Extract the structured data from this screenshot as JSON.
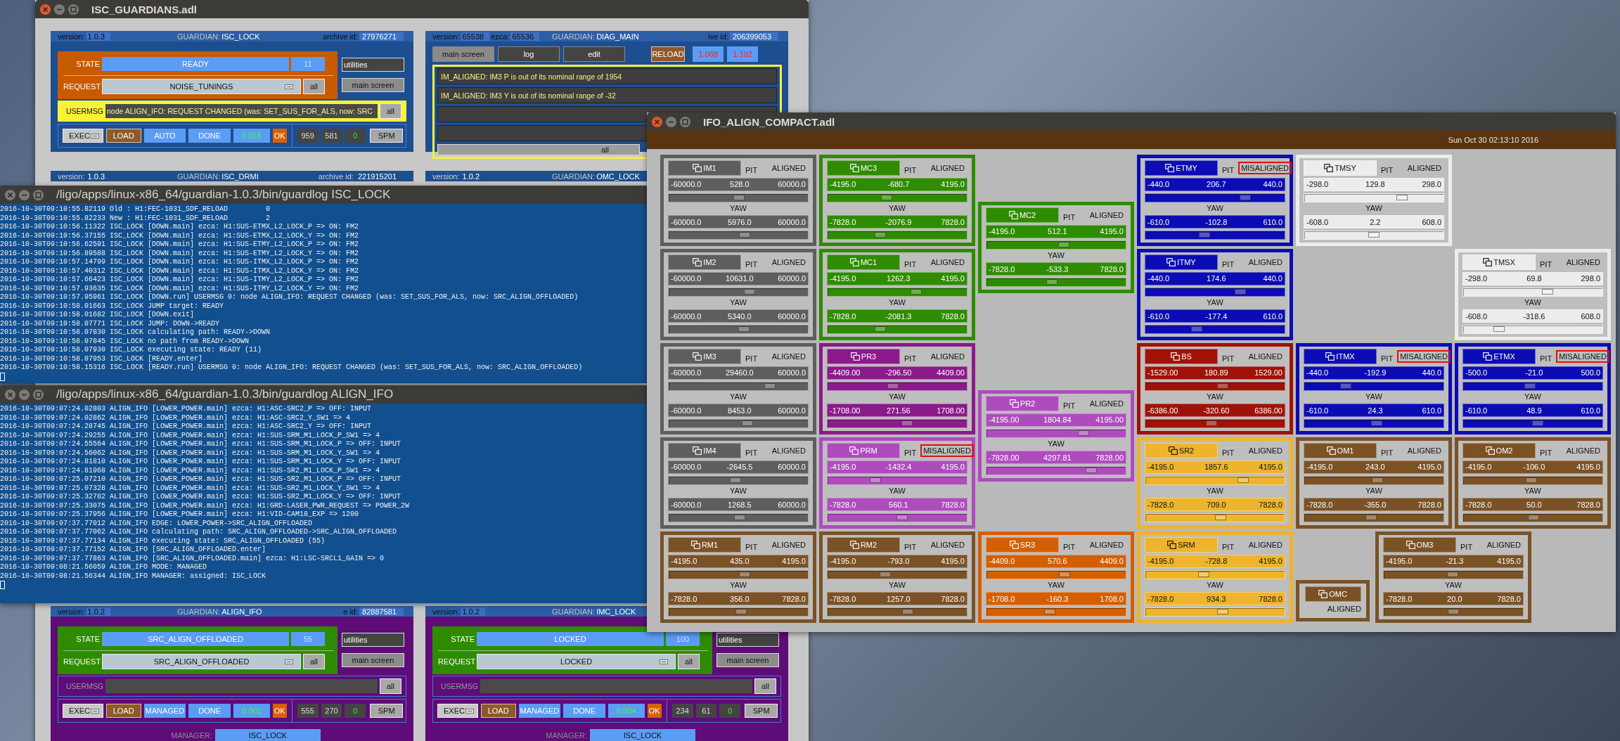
{
  "guardian_window": {
    "title": "ISC_GUARDIANS.adl",
    "rows": [
      [
        {
          "kind": "node",
          "color": "#1d4e8f",
          "state_box": {
            "color": "#c85a00"
          },
          "header": {
            "version_label": "version:",
            "version": "1.0.3",
            "guardian_label": "GUARDIAN:",
            "guardian": "ISC_LOCK",
            "id_label": "archive id:",
            "id": "27976271"
          },
          "state_label": "STATE",
          "state": "READY",
          "state_index": "11",
          "request_label": "REQUEST",
          "request": "NOISE_TUNINGS",
          "request_all": "all",
          "side_buttons": [
            "utilities",
            "main screen"
          ],
          "usermsg_label": "USERMSG",
          "usermsg": "node ALIGN_IFO: REQUEST CHANGED (was: SET_SUS_FOR_ALS, now: SRC",
          "usermsg_alert": true,
          "usermsg_all": "all",
          "exec": "EXEC",
          "load": "LOAD",
          "mode": "AUTO",
          "status": "DONE",
          "timing": "0.018",
          "ok": "OK",
          "counters": [
            "959",
            "581",
            "0"
          ],
          "spm": "SPM"
        },
        {
          "kind": "diag",
          "color": "#1d4e8f",
          "header": {
            "version_label": "version:",
            "version": "65538",
            "ezca_label": "ezca:",
            "ezca": "65536",
            "guardian_label": "GUARDIAN:",
            "guardian": "DIAG_MAIN",
            "id_label": "ive id:",
            "id": "206399053"
          },
          "buttons": [
            "main screen",
            "log",
            "edit"
          ],
          "reload": "RELOAD",
          "readings": [
            "1.068",
            "1.102"
          ],
          "messages": [
            "IM_ALIGNED: IM3 P is out of its nominal range of 1954",
            "IM_ALIGNED: IM3 Y is out of its nominal range of -32"
          ],
          "all": "all"
        }
      ],
      [
        {
          "kind": "strip",
          "color": "#1d4e8f",
          "header": {
            "version_label": "version:",
            "version": "1.0.3",
            "guardian_label": "GUARDIAN:",
            "guardian": "ISC_DRMI",
            "id_label": "archive id:",
            "id": "221915201"
          }
        },
        {
          "kind": "strip",
          "color": "#1d4e8f",
          "header": {
            "version_label": "version:",
            "version": "1.0.2",
            "guardian_label": "GUARDIAN:",
            "guardian": "OMC_LOCK"
          }
        }
      ],
      [
        {
          "kind": "node",
          "color": "#5e0c78",
          "state_box": {
            "color": "#2f8c00"
          },
          "header": {
            "version_label": "version:",
            "version": "1.0.2",
            "guardian_label": "GUARDIAN:",
            "guardian": "ALIGN_IFO",
            "id_label": "e id:",
            "id": "82887581"
          },
          "state_label": "STATE",
          "state": "SRC_ALIGN_OFFLOADED",
          "state_index": "55",
          "request_label": "REQUEST",
          "request": "SRC_ALIGN_OFFLOADED",
          "request_all": "all",
          "side_buttons": [
            "utilities",
            "main screen"
          ],
          "usermsg_label": "USERMSG",
          "usermsg_alert": false,
          "usermsg_all": "all",
          "exec": "EXEC",
          "load": "LOAD",
          "mode": "MANAGED",
          "status": "DONE",
          "timing": "0.001",
          "ok": "OK",
          "counters": [
            "555",
            "270",
            "0"
          ],
          "spm": "SPM",
          "manager_label": "MANAGER:",
          "manager": "ISC_LOCK"
        },
        {
          "kind": "node",
          "color": "#5e0c78",
          "state_box": {
            "color": "#2f8c00"
          },
          "header": {
            "version_label": "version:",
            "version": "1.0.2",
            "guardian_label": "GUARDIAN:",
            "guardian": "IMC_LOCK"
          },
          "state_label": "STATE",
          "state": "LOCKED",
          "state_index": "100",
          "request_label": "REQUEST",
          "request": "LOCKED",
          "request_all": "all",
          "side_buttons": [
            "utilities",
            "main screen"
          ],
          "usermsg_label": "USERMSG",
          "usermsg_alert": false,
          "usermsg_all": "all",
          "exec": "EXEC",
          "load": "LOAD",
          "mode": "MANAGED",
          "status": "DONE",
          "timing": "0.004",
          "ok": "OK",
          "counters": [
            "234",
            "61",
            "0"
          ],
          "spm": "SPM",
          "manager_label": "MANAGER:",
          "manager": "ISC_LOCK"
        }
      ]
    ]
  },
  "terminals": [
    {
      "title": "/ligo/apps/linux-x86_64/guardian-1.0.3/bin/guardlog ISC_LOCK",
      "lines": [
        "2016-10-30T09:10:55.82119 Old : H1:FEC-1031_SDF_RELOAD         0",
        "2016-10-30T09:10:55.82233 New : H1:FEC-1031_SDF_RELOAD         2",
        "2016-10-30T09:10:56.11322 ISC_LOCK [DOWN.main] ezca: H1:SUS-ETMX_L2_LOCK_P => ON: FM2",
        "2016-10-30T09:10:56.37155 ISC_LOCK [DOWN.main] ezca: H1:SUS-ETMX_L2_LOCK_Y => ON: FM2",
        "2016-10-30T09:10:56.62591 ISC_LOCK [DOWN.main] ezca: H1:SUS-ETMY_L2_LOCK_P => ON: FM2",
        "2016-10-30T09:10:56.89588 ISC_LOCK [DOWN.main] ezca: H1:SUS-ETMY_L2_LOCK_Y => ON: FM2",
        "2016-10-30T09:10:57.14799 ISC_LOCK [DOWN.main] ezca: H1:SUS-ITMX_L2_LOCK_P => ON: FM2",
        "2016-10-30T09:10:57.40312 ISC_LOCK [DOWN.main] ezca: H1:SUS-ITMX_L2_LOCK_Y => ON: FM2",
        "2016-10-30T09:10:57.66423 ISC_LOCK [DOWN.main] ezca: H1:SUS-ITMY_L2_LOCK_P => ON: FM2",
        "2016-10-30T09:10:57.93635 ISC_LOCK [DOWN.main] ezca: H1:SUS-ITMY_L2_LOCK_Y => ON: FM2",
        "2016-10-30T09:10:57.95961 ISC_LOCK [DOWN.run] USERMSG 0: node ALIGN_IFO: REQUEST CHANGED (was: SET_SUS_FOR_ALS, now: SRC_ALIGN_OFFLOADED)",
        "2016-10-30T09:10:58.01663 ISC_LOCK JUMP target: READY",
        "2016-10-30T09:10:58.01682 ISC_LOCK [DOWN.exit]",
        "2016-10-30T09:10:58.07771 ISC_LOCK JUMP: DOWN->READY",
        "2016-10-30T09:10:58.07830 ISC_LOCK calculating path: READY->DOWN",
        "2016-10-30T09:10:58.07845 ISC_LOCK no path from READY->DOWN",
        "2016-10-30T09:10:58.07930 ISC_LOCK executing state: READY (11)",
        "2016-10-30T09:10:58.07953 ISC_LOCK [READY.enter]",
        "2016-10-30T09:10:58.15316 ISC_LOCK [READY.run] USERMSG 0: node ALIGN_IFO: REQUEST CHANGED (was: SET_SUS_FOR_ALS, now: SRC_ALIGN_OFFLOADED)"
      ]
    },
    {
      "title": "/ligo/apps/linux-x86_64/guardian-1.0.3/bin/guardlog ALIGN_IFO",
      "lines": [
        "2016-10-30T09:07:24.02803 ALIGN_IFO [LOWER_POWER.main] ezca: H1:ASC-SRC2_P => OFF: INPUT",
        "2016-10-30T09:07:24.02862 ALIGN_IFO [LOWER_POWER.main] ezca: H1:ASC-SRC2_Y_SW1 => 4",
        "2016-10-30T09:07:24.28745 ALIGN_IFO [LOWER_POWER.main] ezca: H1:ASC-SRC2_Y => OFF: INPUT",
        "2016-10-30T09:07:24.29255 ALIGN_IFO [LOWER_POWER.main] ezca: H1:SUS-SRM_M1_LOCK_P_SW1 => 4",
        "2016-10-30T09:07:24.55564 ALIGN_IFO [LOWER_POWER.main] ezca: H1:SUS-SRM_M1_LOCK_P => OFF: INPUT",
        "2016-10-30T09:07:24.56062 ALIGN_IFO [LOWER_POWER.main] ezca: H1:SUS-SRM_M1_LOCK_Y_SW1 => 4",
        "2016-10-30T09:07:24.81810 ALIGN_IFO [LOWER_POWER.main] ezca: H1:SUS-SRM_M1_LOCK_Y => OFF: INPUT",
        "2016-10-30T09:07:24.81968 ALIGN_IFO [LOWER_POWER.main] ezca: H1:SUS-SR2_M1_LOCK_P_SW1 => 4",
        "2016-10-30T09:07:25.07210 ALIGN_IFO [LOWER_POWER.main] ezca: H1:SUS-SR2_M1_LOCK_P => OFF: INPUT",
        "2016-10-30T09:07:25.07328 ALIGN_IFO [LOWER_POWER.main] ezca: H1:SUS-SR2_M1_LOCK_Y_SW1 => 4",
        "2016-10-30T09:07:25.32782 ALIGN_IFO [LOWER_POWER.main] ezca: H1:SUS-SR2_M1_LOCK_Y => OFF: INPUT",
        "2016-10-30T09:07:25.33075 ALIGN_IFO [LOWER_POWER.main] ezca: H1:GRD-LASER_PWR_REQUEST => POWER_2W",
        "2016-10-30T09:07:25.37956 ALIGN_IFO [LOWER_POWER.main] ezca: H1:VID-CAM18_EXP => 1200",
        "2016-10-30T09:07:37.77012 ALIGN_IFO EDGE: LOWER_POWER->SRC_ALIGN_OFFLOADED",
        "2016-10-30T09:07:37.77062 ALIGN_IFO calculating path: SRC_ALIGN_OFFLOADED->SRC_ALIGN_OFFLOADED",
        "2016-10-30T09:07:37.77134 ALIGN_IFO executing state: SRC_ALIGN_OFFLOADED (55)",
        "2016-10-30T09:07:37.77152 ALIGN_IFO [SRC_ALIGN_OFFLOADED.enter]",
        "2016-10-30T09:07:37.77863 ALIGN_IFO [SRC_ALIGN_OFFLOADED.main] ezca: H1:LSC-SRCL1_GAIN => 0",
        "2016-10-30T09:08:21.56059 ALIGN_IFO MODE: MANAGED",
        "2016-10-30T09:08:21.56344 ALIGN_IFO MANAGER: assigned: ISC_LOCK"
      ]
    }
  ],
  "ifo_window": {
    "title": "IFO_ALIGN_COMPACT.adl",
    "timestamp": "Sun Oct 30 02:13:10 2016",
    "optics": [
      {
        "kind": "full",
        "name": "IM1",
        "color": "#5e5e5e",
        "pit_label": "PIT",
        "status": "ALIGNED",
        "misaligned": false,
        "pit": {
          "min": "-60000.0",
          "value": "528.0",
          "max": "60000.0",
          "level": 0.504
        },
        "yaw_label": "YAW",
        "yaw": {
          "min": "-60000.0",
          "value": "5976.0",
          "max": "60000.0",
          "level": 0.55
        }
      },
      {
        "kind": "full",
        "name": "MC3",
        "color": "#2f8c00",
        "pit_label": "PIT",
        "status": "ALIGNED",
        "misaligned": false,
        "pit": {
          "min": "-4195.0",
          "value": "-680.7",
          "max": "4195.0",
          "level": 0.419
        },
        "yaw_label": "YAW",
        "yaw": {
          "min": "-7828.0",
          "value": "-2076.9",
          "max": "7828.0",
          "level": 0.367
        }
      },
      {
        "kind": "full",
        "name": "MC2",
        "color": "#2f8c00",
        "pit_label": "PIT",
        "status": "ALIGNED",
        "misaligned": false,
        "pit": {
          "min": "-4195.0",
          "value": "512.1",
          "max": "4195.0",
          "level": 0.561
        },
        "yaw_label": "YAW",
        "yaw": {
          "min": "-7828.0",
          "value": "-533.3",
          "max": "7828.0",
          "level": 0.466
        }
      },
      {
        "kind": "full",
        "name": "ETMY",
        "color": "#0c0cb4",
        "pit_label": "PIT",
        "status": "MISALIGNED",
        "misaligned": true,
        "pit": {
          "min": "-440.0",
          "value": "206.7",
          "max": "440.0",
          "level": 0.735
        },
        "yaw_label": "YAW",
        "yaw": {
          "min": "-610.0",
          "value": "-102.8",
          "max": "610.0",
          "level": 0.416
        }
      },
      {
        "kind": "full",
        "name": "TMSY",
        "color": "#ececec",
        "pit_label": "PIT",
        "status": "ALIGNED",
        "misaligned": false,
        "pit": {
          "min": "-298.0",
          "value": "129.8",
          "max": "298.0",
          "level": 0.718
        },
        "yaw_label": "YAW",
        "yaw": {
          "min": "-608.0",
          "value": "2.2",
          "max": "608.0",
          "level": 0.502
        }
      },
      {
        "kind": "full",
        "name": "IM2",
        "color": "#5e5e5e",
        "pit_label": "PIT",
        "status": "ALIGNED",
        "misaligned": false,
        "pit": {
          "min": "-60000.0",
          "value": "10631.0",
          "max": "60000.0",
          "level": 0.589
        },
        "yaw_label": "YAW",
        "yaw": {
          "min": "-60000.0",
          "value": "5340.0",
          "max": "60000.0",
          "level": 0.545
        }
      },
      {
        "kind": "full",
        "name": "MC1",
        "color": "#2f8c00",
        "pit_label": "PIT",
        "status": "ALIGNED",
        "misaligned": false,
        "pit": {
          "min": "-4195.0",
          "value": "1262.3",
          "max": "4195.0",
          "level": 0.65
        },
        "yaw_label": "YAW",
        "yaw": {
          "min": "-7828.0",
          "value": "-2081.3",
          "max": "7828.0",
          "level": 0.367
        }
      },
      {
        "kind": "full",
        "name": "ITMY",
        "color": "#0c0cb4",
        "pit_label": "PIT",
        "status": "ALIGNED",
        "misaligned": false,
        "pit": {
          "min": "-440.0",
          "value": "174.6",
          "max": "440.0",
          "level": 0.698
        },
        "yaw_label": "YAW",
        "yaw": {
          "min": "-610.0",
          "value": "-177.4",
          "max": "610.0",
          "level": 0.355
        }
      },
      {
        "kind": "full",
        "name": "TMSX",
        "color": "#ececec",
        "pit_label": "PIT",
        "status": "ALIGNED",
        "misaligned": false,
        "pit": {
          "min": "-298.0",
          "value": "69.8",
          "max": "298.0",
          "level": 0.617
        },
        "yaw_label": "YAW",
        "yaw": {
          "min": "-608.0",
          "value": "-318.6",
          "max": "608.0",
          "level": 0.238
        }
      },
      {
        "kind": "full",
        "name": "IM3",
        "color": "#5e5e5e",
        "pit_label": "PIT",
        "status": "ALIGNED",
        "misaligned": false,
        "pit": {
          "min": "-60000.0",
          "value": "29460.0",
          "max": "60000.0",
          "level": 0.746
        },
        "yaw_label": "YAW",
        "yaw": {
          "min": "-60000.0",
          "value": "8453.0",
          "max": "60000.0",
          "level": 0.57
        }
      },
      {
        "kind": "full",
        "name": "PR3",
        "color": "#8b1a8b",
        "pit_label": "PIT",
        "status": "ALIGNED",
        "misaligned": false,
        "pit": {
          "min": "-4409.00",
          "value": "-296.50",
          "max": "4409.00",
          "level": 0.466
        },
        "yaw_label": "YAW",
        "yaw": {
          "min": "-1708.00",
          "value": "271.56",
          "max": "1708.00",
          "level": 0.579
        }
      },
      {
        "kind": "full",
        "name": "PR2",
        "color": "#ae4cbe",
        "pit_label": "PIT",
        "status": "ALIGNED",
        "misaligned": false,
        "pit": {
          "min": "-4195.00",
          "value": "1804.84",
          "max": "4195.00",
          "level": 0.715
        },
        "yaw_label": "YAW",
        "yaw": {
          "min": "-7828.00",
          "value": "4297.81",
          "max": "7828.00",
          "level": 0.775
        }
      },
      {
        "kind": "full",
        "name": "BS",
        "color": "#a01208",
        "pit_label": "PIT",
        "status": "ALIGNED",
        "misaligned": false,
        "pit": {
          "min": "-1529.00",
          "value": "180.89",
          "max": "1529.00",
          "level": 0.559
        },
        "yaw_label": "YAW",
        "yaw": {
          "min": "-6386.00",
          "value": "-320.60",
          "max": "6386.00",
          "level": 0.475
        }
      },
      {
        "kind": "full",
        "name": "ITMX",
        "color": "#0c0cb4",
        "pit_label": "PIT",
        "status": "MISALIGNED",
        "misaligned": true,
        "pit": {
          "min": "-440.0",
          "value": "-192.9",
          "max": "440.0",
          "level": 0.281
        },
        "yaw_label": "YAW",
        "yaw": {
          "min": "-610.0",
          "value": "24.3",
          "max": "610.0",
          "level": 0.52
        }
      },
      {
        "kind": "full",
        "name": "ETMX",
        "color": "#0c0cb4",
        "pit_label": "PIT",
        "status": "MISALIGNED",
        "misaligned": true,
        "pit": {
          "min": "-500.0",
          "value": "-21.0",
          "max": "500.0",
          "level": 0.479
        },
        "yaw_label": "YAW",
        "yaw": {
          "min": "-610.0",
          "value": "48.9",
          "max": "610.0",
          "level": 0.54
        }
      },
      {
        "kind": "full",
        "name": "IM4",
        "color": "#5e5e5e",
        "pit_label": "PIT",
        "status": "ALIGNED",
        "misaligned": false,
        "pit": {
          "min": "-60000.0",
          "value": "-2645.5",
          "max": "60000.0",
          "level": 0.478
        },
        "yaw_label": "YAW",
        "yaw": {
          "min": "-60000.0",
          "value": "1268.5",
          "max": "60000.0",
          "level": 0.511
        }
      },
      {
        "kind": "full",
        "name": "PRM",
        "color": "#ae4cbe",
        "pit_label": "PIT",
        "status": "MISALIGNED",
        "misaligned": true,
        "pit": {
          "min": "-4195.0",
          "value": "-1432.4",
          "max": "4195.0",
          "level": 0.329
        },
        "yaw_label": "YAW",
        "yaw": {
          "min": "-7828.0",
          "value": "560.1",
          "max": "7828.0",
          "level": 0.536
        }
      },
      {
        "kind": "full",
        "name": "SR2",
        "color": "#eeb52c",
        "pit_label": "PIT",
        "status": "ALIGNED",
        "misaligned": false,
        "pit": {
          "min": "-4195.0",
          "value": "1857.6",
          "max": "4195.0",
          "level": 0.721
        },
        "yaw_label": "YAW",
        "yaw": {
          "min": "-7828.0",
          "value": "709.0",
          "max": "7828.0",
          "level": 0.545
        }
      },
      {
        "kind": "full",
        "name": "OM1",
        "color": "#7a5226",
        "pit_label": "PIT",
        "status": "ALIGNED",
        "misaligned": false,
        "pit": {
          "min": "-4195.0",
          "value": "243.0",
          "max": "4195.0",
          "level": 0.529
        },
        "yaw_label": "YAW",
        "yaw": {
          "min": "-7828.0",
          "value": "-355.0",
          "max": "7828.0",
          "level": 0.477
        }
      },
      {
        "kind": "full",
        "name": "OM2",
        "color": "#7a5226",
        "pit_label": "PIT",
        "status": "ALIGNED",
        "misaligned": false,
        "pit": {
          "min": "-4195.0",
          "value": "-106.0",
          "max": "4195.0",
          "level": 0.487
        },
        "yaw_label": "YAW",
        "yaw": {
          "min": "-7828.0",
          "value": "50.0",
          "max": "7828.0",
          "level": 0.503
        }
      },
      {
        "kind": "full",
        "name": "RM1",
        "color": "#7a5226",
        "pit_label": "PIT",
        "status": "ALIGNED",
        "misaligned": false,
        "pit": {
          "min": "-4195.0",
          "value": "435.0",
          "max": "4195.0",
          "level": 0.552
        },
        "yaw_label": "YAW",
        "yaw": {
          "min": "-7828.0",
          "value": "356.0",
          "max": "7828.0",
          "level": 0.523
        }
      },
      {
        "kind": "full",
        "name": "RM2",
        "color": "#7a5226",
        "pit_label": "PIT",
        "status": "ALIGNED",
        "misaligned": false,
        "pit": {
          "min": "-4195.0",
          "value": "-793.0",
          "max": "4195.0",
          "level": 0.405
        },
        "yaw_label": "YAW",
        "yaw": {
          "min": "-7828.0",
          "value": "1257.0",
          "max": "7828.0",
          "level": 0.58
        }
      },
      {
        "kind": "full",
        "name": "SR3",
        "color": "#d45f00",
        "pit_label": "PIT",
        "status": "ALIGNED",
        "misaligned": false,
        "pit": {
          "min": "-4409.0",
          "value": "570.6",
          "max": "4409.0",
          "level": 0.565
        },
        "yaw_label": "YAW",
        "yaw": {
          "min": "-1708.0",
          "value": "-160.3",
          "max": "1708.0",
          "level": 0.453
        }
      },
      {
        "kind": "full",
        "name": "SRM",
        "color": "#eeb52c",
        "pit_label": "PIT",
        "status": "ALIGNED",
        "misaligned": false,
        "pit": {
          "min": "-4195.0",
          "value": "-728.8",
          "max": "4195.0",
          "level": 0.413
        },
        "yaw_label": "YAW",
        "yaw": {
          "min": "-7828.0",
          "value": "934.3",
          "max": "7828.0",
          "level": 0.56
        }
      },
      {
        "kind": "status_only",
        "name": "OMC",
        "color": "#7a5226",
        "status": "ALIGNED",
        "misaligned": false
      },
      {
        "kind": "full",
        "name": "OM3",
        "color": "#7a5226",
        "pit_label": "PIT",
        "status": "ALIGNED",
        "misaligned": false,
        "pit": {
          "min": "-4195.0",
          "value": "-21.3",
          "max": "4195.0",
          "level": 0.497
        },
        "yaw_label": "YAW",
        "yaw": {
          "min": "-7828.0",
          "value": "20.0",
          "max": "7828.0",
          "level": 0.501
        }
      }
    ]
  }
}
